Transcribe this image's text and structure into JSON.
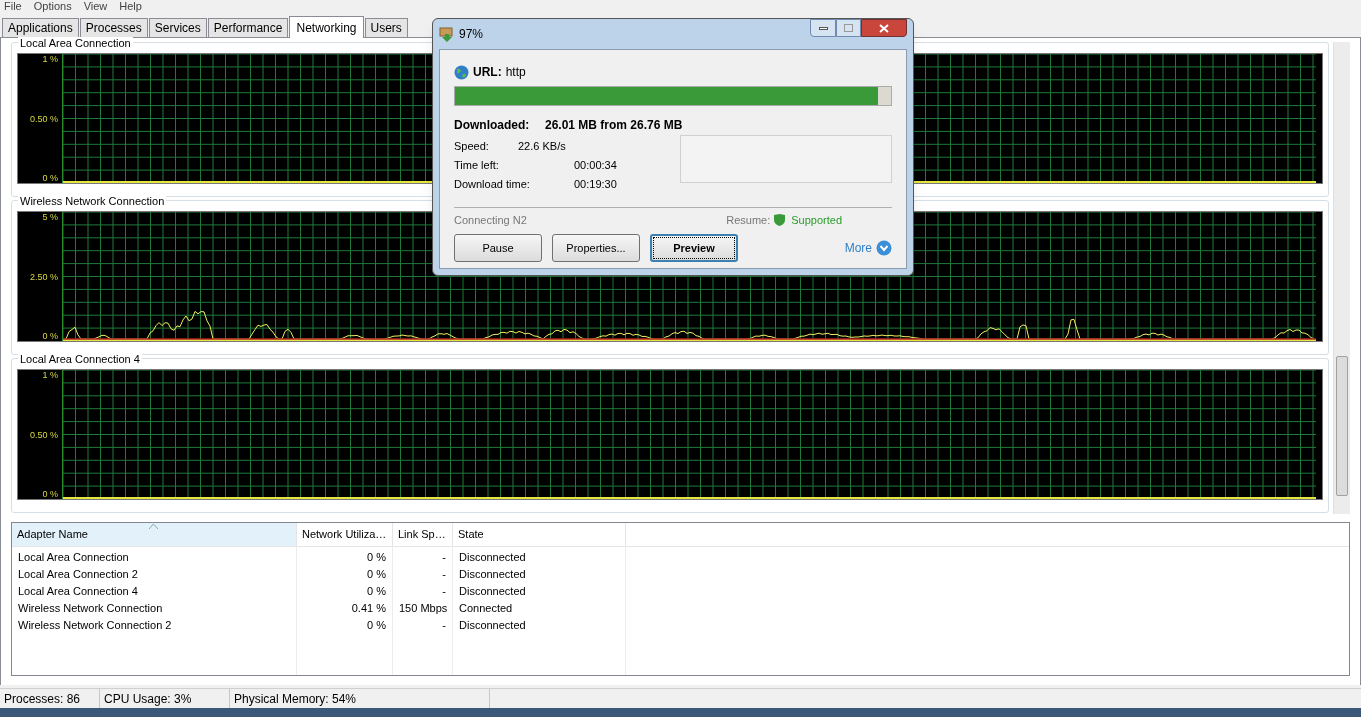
{
  "menu": [
    "File",
    "Options",
    "View",
    "Help"
  ],
  "tabs": [
    {
      "label": "Applications",
      "selected": false
    },
    {
      "label": "Processes",
      "selected": false
    },
    {
      "label": "Services",
      "selected": false
    },
    {
      "label": "Performance",
      "selected": false
    },
    {
      "label": "Networking",
      "selected": true
    },
    {
      "label": "Users",
      "selected": false
    }
  ],
  "graphs": [
    {
      "title": "Local Area Connection",
      "yticks": [
        "1 %",
        "0.50 %",
        "0 %"
      ],
      "active": false
    },
    {
      "title": "Wireless Network Connection",
      "yticks": [
        "5 %",
        "2.50 %",
        "0 %"
      ],
      "active": true
    },
    {
      "title": "Local Area Connection 4",
      "yticks": [
        "1 %",
        "0.50 %",
        "0 %"
      ],
      "active": false
    }
  ],
  "table": {
    "columns": [
      {
        "label": "Adapter Name",
        "sorted": true
      },
      {
        "label": "Network Utiliza…",
        "sorted": false
      },
      {
        "label": "Link Sp…",
        "sorted": false
      },
      {
        "label": "State",
        "sorted": false
      }
    ],
    "rows": [
      [
        "Local Area Connection",
        "0 %",
        "-",
        "Disconnected"
      ],
      [
        "Local Area Connection 2",
        "0 %",
        "-",
        "Disconnected"
      ],
      [
        "Local Area Connection 4",
        "0 %",
        "-",
        "Disconnected"
      ],
      [
        "Wireless Network Connection",
        "0.41 %",
        "150 Mbps",
        "Connected"
      ],
      [
        "Wireless Network Connection 2",
        "0 %",
        "-",
        "Disconnected"
      ]
    ]
  },
  "status_bar": [
    "Processes: 86",
    "CPU Usage: 3%",
    "Physical Memory: 54%"
  ],
  "download_dialog": {
    "title": "97%",
    "url_label": "URL:",
    "url": "http",
    "level": 0.97,
    "downloaded_label": "Downloaded:",
    "downloaded": "26.01 MB from 26.76 MB",
    "stats": [
      {
        "label": "Speed:",
        "value": "22.6 KB/s"
      },
      {
        "label": "Time left:",
        "value": "00:00:34"
      },
      {
        "label": "Download time:",
        "value": "00:19:30"
      }
    ],
    "status": "Connecting N2",
    "resume_label": "Resume:",
    "resume_value": "Supported",
    "buttons": [
      {
        "label": "Pause",
        "focused": false
      },
      {
        "label": "Properties...",
        "focused": false
      },
      {
        "label": "Preview",
        "focused": true
      }
    ],
    "more": "More"
  }
}
